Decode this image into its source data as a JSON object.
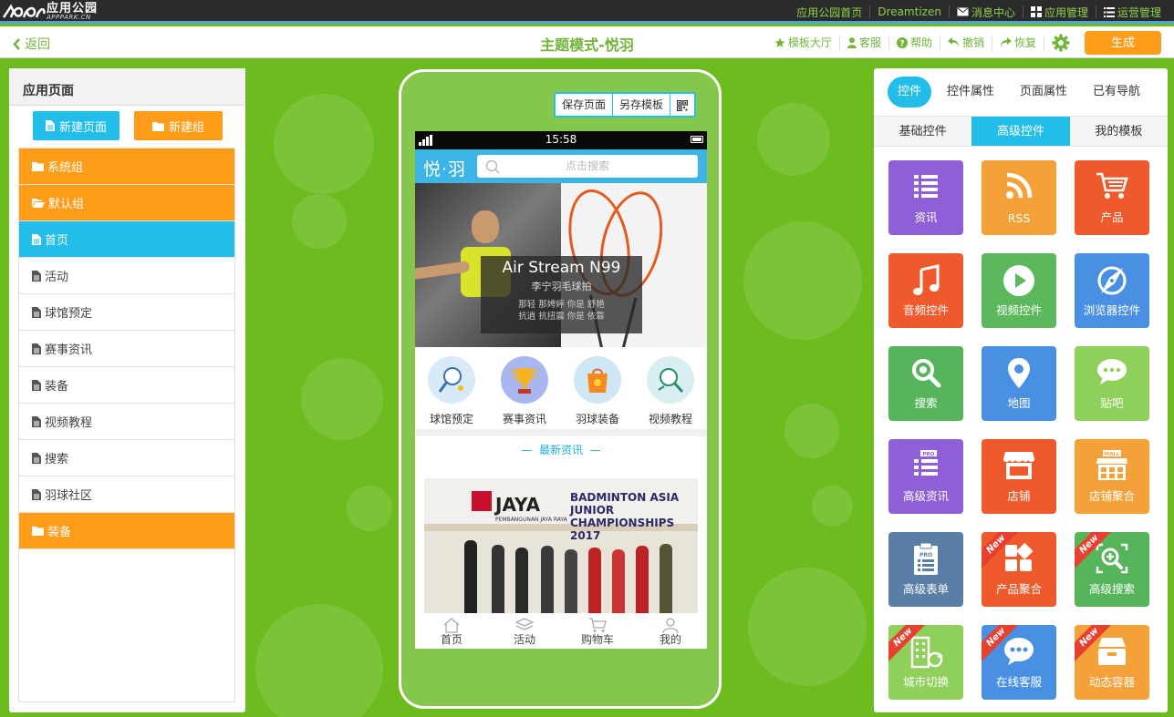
{
  "topbar": {
    "logo_cn": "应用公园",
    "logo_en": "APPPARK.CN",
    "links": [
      "应用公园首页",
      "Dreamtizen",
      "消息中心",
      "应用管理",
      "运营管理"
    ]
  },
  "header": {
    "back": "返回",
    "title": "主题模式-悦羽",
    "tools": [
      "模板大厅",
      "客服",
      "帮助",
      "撤销",
      "恢复"
    ],
    "generate": "生成"
  },
  "left": {
    "heading": "应用页面",
    "new_page": "新建页面",
    "new_group": "新建组",
    "items": [
      {
        "label": "系统组",
        "type": "group"
      },
      {
        "label": "默认组",
        "type": "group-open"
      },
      {
        "label": "首页",
        "type": "active"
      },
      {
        "label": "活动",
        "type": "page"
      },
      {
        "label": "球馆预定",
        "type": "page"
      },
      {
        "label": "赛事资讯",
        "type": "page"
      },
      {
        "label": "装备",
        "type": "page"
      },
      {
        "label": "视频教程",
        "type": "page"
      },
      {
        "label": "搜索",
        "type": "page"
      },
      {
        "label": "羽球社区",
        "type": "page"
      },
      {
        "label": "装备",
        "type": "group"
      }
    ]
  },
  "phone": {
    "save_page": "保存页面",
    "save_template": "另存模板",
    "time": "15:58",
    "app_logo": "悦·羽",
    "search_placeholder": "点击搜索",
    "banner_title": "Air Stream N99",
    "banner_sub": "李宁羽毛球拍",
    "banner_line1": "那轻 那娉婷 你是 舒艳",
    "banner_line2": "抗逍 抗扭震 你是 依靠",
    "shortcuts": [
      "球馆预定",
      "赛事资讯",
      "羽球装备",
      "视频教程"
    ],
    "news_heading": "最新资讯",
    "news_brand": "JAYA",
    "news_brand_sub": "PEMBANGUNAN JAYA RAYA",
    "news_event1": "BADMINTON ASIA JUNIOR",
    "news_event2": "CHAMPIONSHIPS 2017",
    "tabs": [
      "首页",
      "活动",
      "购物车",
      "我的"
    ]
  },
  "right": {
    "main_tabs": [
      "控件",
      "控件属性",
      "页面属性",
      "已有导航"
    ],
    "sub_tabs": [
      "基础控件",
      "高级控件",
      "我的模板"
    ],
    "new_badge": "New",
    "widgets": [
      {
        "label": "资讯",
        "icon": "list-icon",
        "color": "#8e5fd6"
      },
      {
        "label": "RSS",
        "icon": "rss-icon",
        "color": "#f5a13a"
      },
      {
        "label": "产品",
        "icon": "cart-icon",
        "color": "#ef5a2d"
      },
      {
        "label": "音频控件",
        "icon": "music-icon",
        "color": "#ef5a2d"
      },
      {
        "label": "视频控件",
        "icon": "play-icon",
        "color": "#5cb85c"
      },
      {
        "label": "浏览器控件",
        "icon": "compass-icon",
        "color": "#4a90e2"
      },
      {
        "label": "搜索",
        "icon": "search-icon",
        "color": "#56b55a"
      },
      {
        "label": "地图",
        "icon": "map-pin-icon",
        "color": "#4a90e2"
      },
      {
        "label": "贴吧",
        "icon": "chat-icon",
        "color": "#8fd05a"
      },
      {
        "label": "高级资讯",
        "icon": "pro-list-icon",
        "color": "#8e5fd6"
      },
      {
        "label": "店铺",
        "icon": "shop-icon",
        "color": "#ef5a2d"
      },
      {
        "label": "店铺聚合",
        "icon": "mall-icon",
        "color": "#f5a13a"
      },
      {
        "label": "高级表单",
        "icon": "pro-form-icon",
        "color": "#5b7ea6"
      },
      {
        "label": "产品聚合",
        "icon": "grid-icon",
        "color": "#ef5a2d"
      },
      {
        "label": "高级搜索",
        "icon": "adv-search-icon",
        "color": "#56b55a"
      },
      {
        "label": "城市切换",
        "icon": "city-icon",
        "color": "#8fd05a"
      },
      {
        "label": "在线客服",
        "icon": "service-icon",
        "color": "#4a90e2"
      },
      {
        "label": "动态容器",
        "icon": "box-icon",
        "color": "#f5a13a"
      }
    ]
  }
}
